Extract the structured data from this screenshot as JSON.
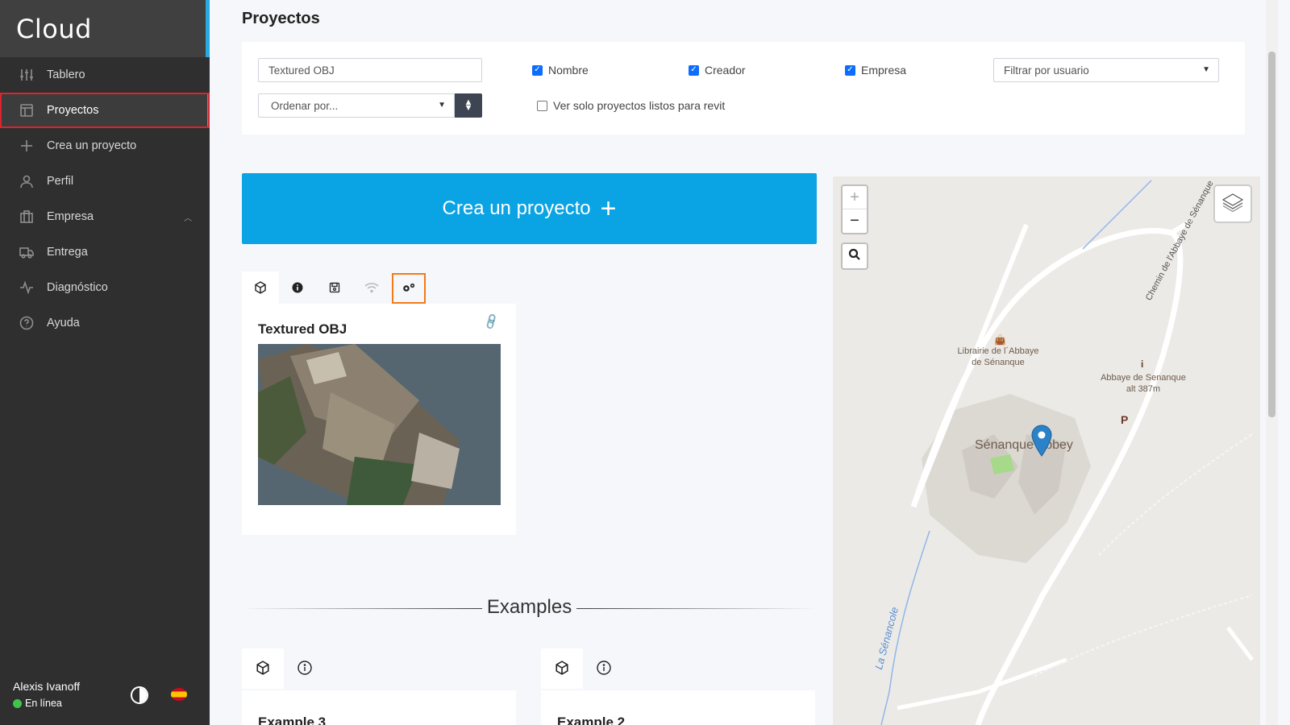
{
  "app": {
    "brand": "Cloud"
  },
  "sidebar": {
    "items": [
      {
        "label": "Tablero",
        "icon": "sliders-icon"
      },
      {
        "label": "Proyectos",
        "icon": "layout-icon",
        "active": true
      },
      {
        "label": "Crea un proyecto",
        "icon": "plus-icon"
      },
      {
        "label": "Perfil",
        "icon": "user-icon"
      },
      {
        "label": "Empresa",
        "icon": "building-icon",
        "expandable": true
      },
      {
        "label": "Entrega",
        "icon": "truck-icon"
      },
      {
        "label": "Diagnóstico",
        "icon": "activity-icon"
      },
      {
        "label": "Ayuda",
        "icon": "help-icon"
      }
    ],
    "user": {
      "name": "Alexis Ivanoff",
      "status": "En línea",
      "status_color": "#3fc54b"
    }
  },
  "main": {
    "title": "Proyectos",
    "filters": {
      "search_value": "Textured OBJ",
      "sort_placeholder": "Ordenar por...",
      "checkboxes": [
        {
          "label": "Nombre",
          "checked": true
        },
        {
          "label": "Creador",
          "checked": true
        },
        {
          "label": "Empresa",
          "checked": true
        },
        {
          "label": "Ver solo proyectos listos para revit",
          "checked": false
        }
      ],
      "user_filter": "Filtrar por usuario"
    },
    "create_banner": {
      "label": "Crea un proyecto",
      "color": "#0aa3e3"
    },
    "project": {
      "title": "Textured OBJ",
      "tabs": [
        "cube-icon",
        "info-icon",
        "save-icon",
        "wifi-icon",
        "gears-icon"
      ]
    },
    "examples": {
      "heading": "Examples",
      "cards": [
        {
          "title": "Example 3"
        },
        {
          "title": "Example 2"
        }
      ]
    }
  },
  "map": {
    "labels": {
      "poi_1": "Librairie de l´Abbaye de Sénanque",
      "poi_2": "Abbaye de Senanque alt 387m",
      "place": "Sénanque Abbey",
      "road": "Chemin de l'Abbaye de Sénanque",
      "river": "La Sénancole",
      "parking": "P",
      "info": "i"
    },
    "zoom_in": "+",
    "zoom_out": "−"
  }
}
